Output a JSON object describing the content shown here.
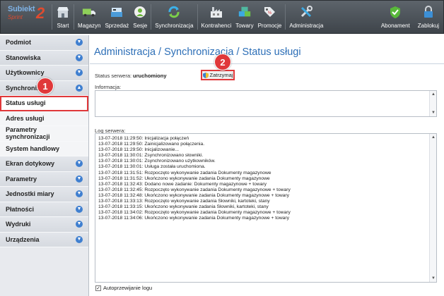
{
  "brand": {
    "name": "Subiekt",
    "subtitle": "Sprint",
    "version": "2"
  },
  "toolbar": {
    "items": [
      {
        "label": "Start",
        "icon": "store-icon"
      },
      {
        "label": "Magazyn",
        "icon": "truck-icon"
      },
      {
        "label": "Sprzedaż",
        "icon": "cashier-icon"
      },
      {
        "label": "Sesje",
        "icon": "user-badge-icon"
      },
      {
        "label": "Synchronizacja",
        "icon": "sync-icon"
      },
      {
        "label": "Kontrahenci",
        "icon": "factory-icon"
      },
      {
        "label": "Towary",
        "icon": "boxes-icon"
      },
      {
        "label": "Promocje",
        "icon": "price-tag-icon"
      },
      {
        "label": "Administracja",
        "icon": "tools-icon"
      }
    ],
    "right_items": [
      {
        "label": "Abonament",
        "icon": "shield-check-icon"
      },
      {
        "label": "Zablokuj",
        "icon": "lock-icon"
      }
    ]
  },
  "sidebar": {
    "items": [
      {
        "label": "Podmiot",
        "chev": "v"
      },
      {
        "label": "Stanowiska",
        "chev": "v"
      },
      {
        "label": "Użytkownicy",
        "chev": "v"
      },
      {
        "label": "Synchronizacja",
        "chev": "^"
      },
      {
        "label": "Status usługi",
        "chev": ""
      },
      {
        "label": "Adres usługi",
        "chev": ""
      },
      {
        "label": "Parametry synchronizacji",
        "chev": ""
      },
      {
        "label": "System handlowy",
        "chev": ""
      },
      {
        "label": "Ekran dotykowy",
        "chev": "v"
      },
      {
        "label": "Parametry",
        "chev": "v"
      },
      {
        "label": "Jednostki miary",
        "chev": "v"
      },
      {
        "label": "Płatności",
        "chev": "v"
      },
      {
        "label": "Wydruki",
        "chev": "v"
      },
      {
        "label": "Urządzenia",
        "chev": "v"
      }
    ]
  },
  "main": {
    "title": "Administracja / Synchronizacja / Status usługi",
    "server_status_label": "Status serwera:",
    "server_status_value": "uruchomiony",
    "stop_button": "Zatrzymaj",
    "info_label": "Informacja:",
    "log_label": "Log serwera:",
    "log": [
      "13-07-2018 11:29:50: Inicjalizacja połączeń",
      "13-07-2018 11:29:50: Zainicjalizowano połączenia.",
      "13-07-2018 11:29:50: Inicjalizowanie...",
      "13-07-2018 11:30:01: Zsynchronizowano słowniki.",
      "13-07-2018 11:30:01: Zsynchronizowano użytkowników.",
      "13-07-2018 11:30:01: Usługa została uruchomiona.",
      "13-07-2018 11:31:51: Rozpoczęto wykonywanie zadania Dokumenty magazynowe",
      "13-07-2018 11:31:52: Ukończono wykonywanie zadania Dokumenty magazynowe",
      "13-07-2018 11:32:43: Dodano nowe zadanie: Dokumenty magazynowe + towary",
      "13-07-2018 11:32:45: Rozpoczęto wykonywanie zadania Dokumenty magazynowe + towary",
      "13-07-2018 11:32:48: Ukończono wykonywanie zadania Dokumenty magazynowe + towary",
      "13-07-2018 11:33:13: Rozpoczęto wykonywanie zadania Słowniki, kartoteki, stany",
      "13-07-2018 11:33:15: Ukończono wykonywanie zadania Słowniki, kartoteki, stany",
      "13-07-2018 11:34:02: Rozpoczęto wykonywanie zadania Dokumenty magazynowe + towary",
      "13-07-2018 11:34:06: Ukończono wykonywanie zadania Dokumenty magazynowe + towary"
    ],
    "autoscroll_label": "Autoprzewijanie logu",
    "autoscroll_checked": "✓"
  },
  "markers": {
    "one": "1",
    "two": "2"
  }
}
